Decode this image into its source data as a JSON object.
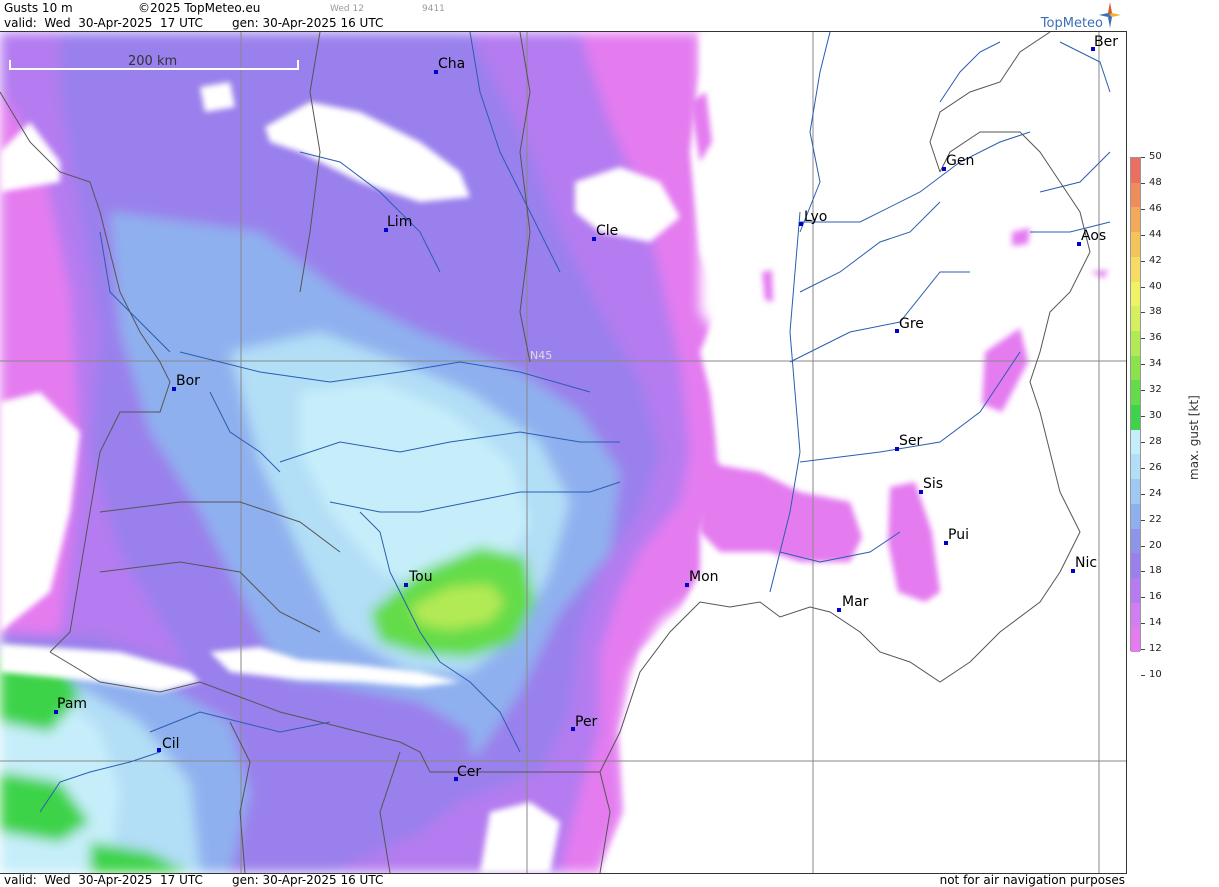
{
  "header": {
    "product": "Gusts 10 m",
    "copyright": "©2025 TopMeteo.eu",
    "tiny_a": "Wed 12",
    "tiny_b": "9411",
    "valid": "valid:  Wed  30-Apr-2025  17 UTC",
    "gen": "gen: 30-Apr-2025 16 UTC",
    "logo": "TopMeteo"
  },
  "footer": {
    "valid": "valid:  Wed  30-Apr-2025  17 UTC",
    "gen": "gen: 30-Apr-2025 16 UTC",
    "note": "not for air navigation purposes"
  },
  "map": {
    "scale_label": "200 km",
    "lat_label": "N45",
    "cities": [
      {
        "id": "cha",
        "name": "Cha"
      },
      {
        "id": "ber",
        "name": "Ber"
      },
      {
        "id": "gen",
        "name": "Gen"
      },
      {
        "id": "lim",
        "name": "Lim"
      },
      {
        "id": "lyo",
        "name": "Lyo"
      },
      {
        "id": "cle",
        "name": "Cle"
      },
      {
        "id": "aos",
        "name": "Aos"
      },
      {
        "id": "gre",
        "name": "Gre"
      },
      {
        "id": "bor",
        "name": "Bor"
      },
      {
        "id": "ser",
        "name": "Ser"
      },
      {
        "id": "sis",
        "name": "Sis"
      },
      {
        "id": "pui",
        "name": "Pui"
      },
      {
        "id": "nic",
        "name": "Nic"
      },
      {
        "id": "tou",
        "name": "Tou"
      },
      {
        "id": "mon",
        "name": "Mon"
      },
      {
        "id": "mar",
        "name": "Mar"
      },
      {
        "id": "pam",
        "name": "Pam"
      },
      {
        "id": "per",
        "name": "Per"
      },
      {
        "id": "cil",
        "name": "Cil"
      },
      {
        "id": "cer",
        "name": "Cer"
      }
    ]
  },
  "legend": {
    "unit": "max. gust  [kt]",
    "ticks": [
      "50",
      "48",
      "46",
      "44",
      "42",
      "40",
      "38",
      "36",
      "34",
      "32",
      "30",
      "28",
      "26",
      "24",
      "22",
      "20",
      "18",
      "16",
      "14",
      "12",
      "10"
    ],
    "colors": {
      "12": "#e47cf0",
      "14": "#d27ef2",
      "16": "#b47cf0",
      "18": "#9a80ec",
      "20": "#8e94ea",
      "22": "#8fb0ef",
      "24": "#9fc8f4",
      "26": "#b2def6",
      "28": "#c6eefa",
      "30": "#3ed34a",
      "32": "#64dc4a",
      "34": "#8ae34c",
      "36": "#b2ea55",
      "38": "#d6ef5e",
      "40": "#f0f266",
      "42": "#f6dc62",
      "44": "#f4c45a",
      "46": "#f2a95a",
      "48": "#ef8c5c",
      "50": "#ec6e5e"
    }
  }
}
